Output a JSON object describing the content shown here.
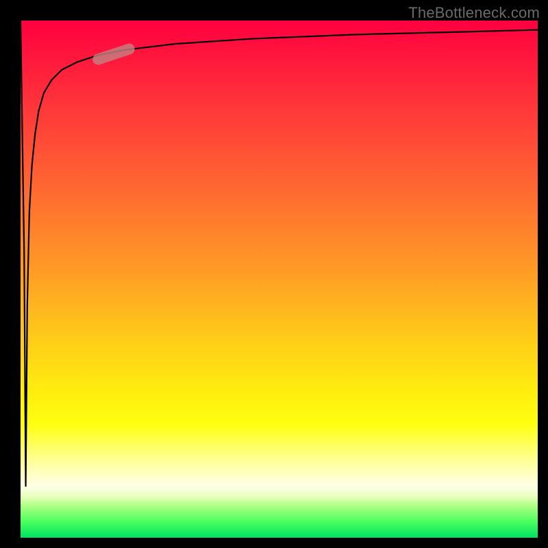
{
  "watermark": "TheBottleneck.com",
  "chart_data": {
    "type": "line",
    "title": "",
    "xlabel": "",
    "ylabel": "",
    "xlim": [
      0,
      100
    ],
    "ylim": [
      0,
      100
    ],
    "background_gradient": {
      "direction": "vertical",
      "stops": [
        {
          "pos": 0,
          "color": "#ff0040"
        },
        {
          "pos": 50,
          "color": "#ff9a26"
        },
        {
          "pos": 78,
          "color": "#ffff10"
        },
        {
          "pos": 100,
          "color": "#00e060"
        }
      ]
    },
    "series": [
      {
        "name": "bottleneck-curve",
        "x": [
          0,
          0.7,
          1.0,
          1.3,
          1.7,
          2.2,
          2.8,
          3.5,
          4.5,
          6,
          8,
          11,
          15,
          20,
          30,
          45,
          65,
          85,
          100
        ],
        "y": [
          100,
          55,
          10,
          45,
          63,
          72,
          78,
          82.5,
          86,
          88.5,
          90.5,
          92,
          93.3,
          94.3,
          95.5,
          96.5,
          97.3,
          97.8,
          98.2
        ]
      }
    ],
    "marker": {
      "name": "highlight-pill",
      "approx_x_range": [
        15,
        21
      ],
      "approx_y_range": [
        92.5,
        94.5
      ],
      "color": "#c48080"
    }
  }
}
